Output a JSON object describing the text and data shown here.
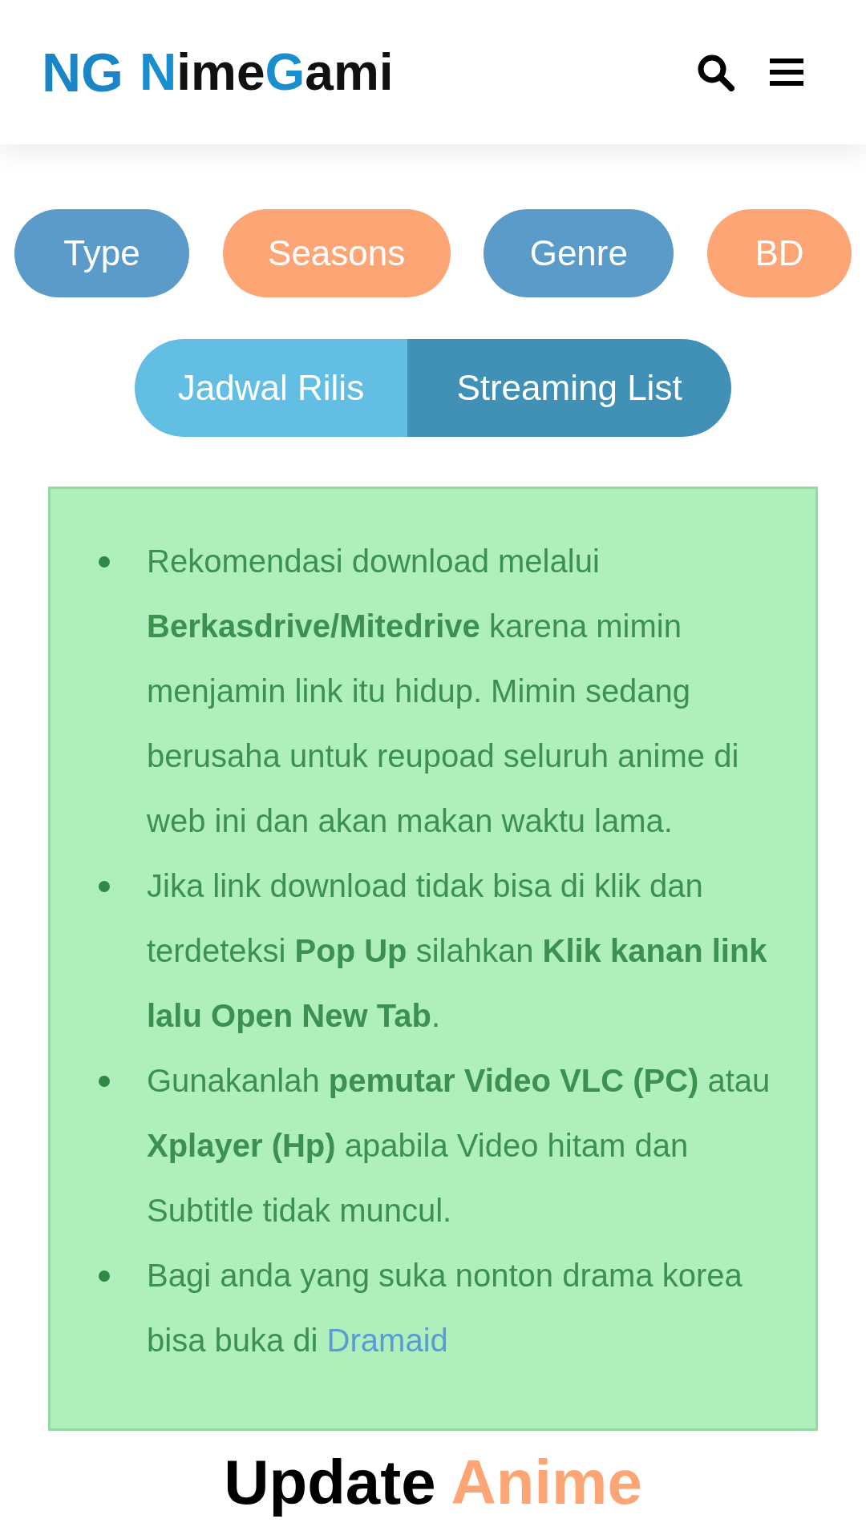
{
  "header": {
    "logo_mark": "NG",
    "logo_parts": [
      {
        "text": "N",
        "accent": true
      },
      {
        "text": "ime",
        "accent": false
      },
      {
        "text": "G",
        "accent": true
      },
      {
        "text": "ami",
        "accent": false
      }
    ]
  },
  "category_buttons": [
    "Type",
    "Seasons",
    "Genre",
    "BD"
  ],
  "segment_buttons": [
    "Jadwal Rilis",
    "Streaming List"
  ],
  "notice": [
    {
      "text": "Rekomendasi download melalui **Berkasdrive/Mitedrive** karena mimin menjamin link itu hidup. Mimin sedang berusaha untuk reupoad seluruh anime di web ini dan akan makan waktu lama."
    },
    {
      "text": "Jika link download tidak bisa di klik dan terdeteksi **Pop Up** silahkan **Klik kanan link lalu Open New Tab**."
    },
    {
      "text": "Gunakanlah **pemutar Video VLC (PC)** atau **Xplayer (Hp)** apabila Video hitam dan Subtitle tidak muncul."
    },
    {
      "text": "Bagi anda yang suka nonton drama korea bisa buka di",
      "link": "Dramaid"
    }
  ],
  "section_heading": {
    "text": "Update",
    "accent": "Anime"
  }
}
